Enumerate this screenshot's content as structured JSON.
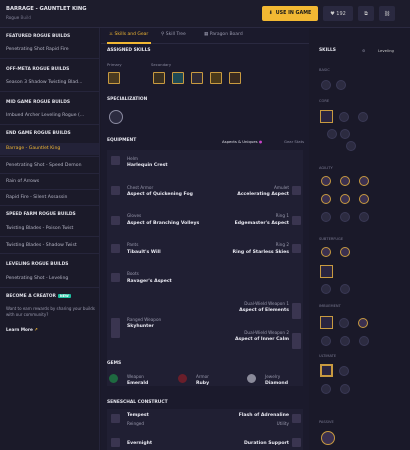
{
  "header": {
    "title": "BARRAGE - GAUNTLET KING",
    "subtitle": "Rogue",
    "use_in_game": "USE IN GAME",
    "likes": "192"
  },
  "sidebar": {
    "sections": [
      {
        "title": "FEATURED ROGUE BUILDS",
        "items": [
          "Penetrating Shot Rapid Fire"
        ]
      },
      {
        "title": "OFF-META ROGUE BUILDS",
        "items": [
          "Season 3 Shadow Twisting Blad..."
        ]
      },
      {
        "title": "MID GAME ROGUE BUILDS",
        "items": [
          "Imbued Archer Leveling Rogue (..."
        ]
      },
      {
        "title": "END GAME ROGUE BUILDS",
        "items": [
          "Barrage - Gauntlet King",
          "Penetrating Shot - Speed Demon",
          "Rain of Arrows",
          "Rapid Fire - Silent Assassin"
        ]
      },
      {
        "title": "SPEED FARM ROGUE BUILDS",
        "items": [
          "Twisting Blades - Poison Twist",
          "Twisting Blades - Shadow Twist"
        ]
      },
      {
        "title": "LEVELING ROGUE BUILDS",
        "items": [
          "Penetrating Shot - Leveling"
        ]
      }
    ],
    "creator_title": "BECOME A CREATOR",
    "creator_badge": "NEW",
    "creator_text": "Want to earn rewards by sharing your builds with our community?",
    "learn_more": "Learn More"
  },
  "tabs": [
    "Skills and Gear",
    "Skill Tree",
    "Paragon Board"
  ],
  "assigned_skills": {
    "title": "ASSIGNED SKILLS",
    "primary": "Primary",
    "secondary": "Secondary"
  },
  "specialization": "SPECIALIZATION",
  "equipment": {
    "title": "EQUIPMENT",
    "aspects": "Aspects & Uniques",
    "gear": "Gear Stats",
    "left": [
      {
        "slot": "Helm",
        "name": "Harlequin Crest"
      },
      {
        "slot": "Chest Armor",
        "name": "Aspect of Quickening Fog"
      },
      {
        "slot": "Gloves",
        "name": "Aspect of Branching Volleys"
      },
      {
        "slot": "Pants",
        "name": "Tibault's Will"
      },
      {
        "slot": "Boots",
        "name": "Ravager's Aspect"
      },
      {
        "slot": "Ranged Weapon",
        "name": "Skyhunter"
      }
    ],
    "right": [
      {
        "slot": "Amulet",
        "name": "Accelerating Aspect"
      },
      {
        "slot": "Ring 1",
        "name": "Edgemaster's Aspect"
      },
      {
        "slot": "Ring 2",
        "name": "Ring of Starless Skies"
      },
      {
        "slot": "Dual-Wield Weapon 1",
        "name": "Aspect of Elements"
      },
      {
        "slot": "Dual-Wield Weapon 2",
        "name": "Aspect of Inner Calm"
      }
    ]
  },
  "gems": {
    "title": "GEMS",
    "items": [
      {
        "slot": "Weapon",
        "name": "Emerald"
      },
      {
        "slot": "Armor",
        "name": "Ruby"
      },
      {
        "slot": "Jewelry",
        "name": "Diamond"
      }
    ]
  },
  "seneschal": {
    "title": "SENESCHAL CONSTRUCT",
    "items": [
      {
        "name": "Tempest",
        "sub": "Reinged"
      },
      {
        "name": "Flash of Adrenaline",
        "sub": "Utility"
      },
      {
        "name": "Evernight",
        "sub": ""
      },
      {
        "name": "Duration Support",
        "sub": ""
      }
    ]
  },
  "right_panel": {
    "title": "SKILLS",
    "leveling": "Leveling",
    "cats": [
      "BASIC",
      "CORE",
      "AGILITY",
      "SUBTERFUGE",
      "IMBUEMENT",
      "ULTIMATE",
      "PASSIVE"
    ]
  },
  "colors": {
    "accent": "#f2b833",
    "bg": "#1a1929"
  }
}
